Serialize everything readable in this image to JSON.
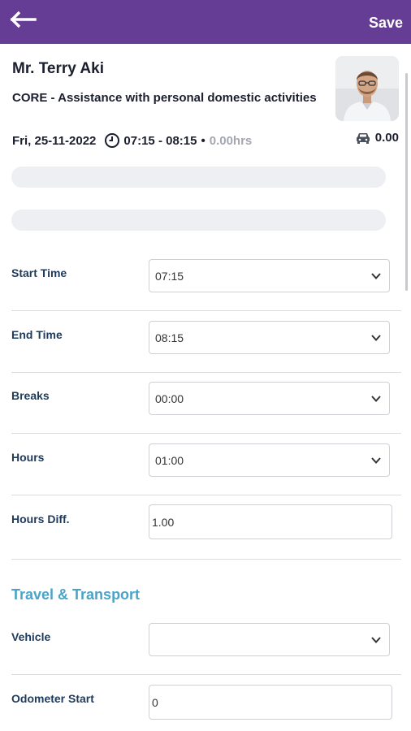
{
  "header": {
    "back_icon": "arrow-left-icon",
    "save_label": "Save",
    "accent_color": "#663d94"
  },
  "visit": {
    "client_name": "Mr. Terry Aki",
    "service": "CORE - Assistance with personal domestic activities",
    "date": "Fri, 25-11-2022",
    "time_range": "07:15 - 08:15",
    "separator": "•",
    "duration": "0.00hrs",
    "travel_amount": "0.00",
    "clock_icon": "clock-icon",
    "car_icon": "car-icon"
  },
  "form": {
    "start_time": {
      "label": "Start Time",
      "value": "07:15"
    },
    "end_time": {
      "label": "End Time",
      "value": "08:15"
    },
    "breaks": {
      "label": "Breaks",
      "value": "00:00"
    },
    "hours": {
      "label": "Hours",
      "value": "01:00"
    },
    "hours_diff": {
      "label": "Hours Diff.",
      "value": "1.00"
    }
  },
  "travel": {
    "section_title": "Travel & Transport",
    "section_color": "#4aa3c8",
    "vehicle": {
      "label": "Vehicle",
      "value": ""
    },
    "odometer_start": {
      "label": "Odometer Start",
      "value": "0"
    }
  }
}
